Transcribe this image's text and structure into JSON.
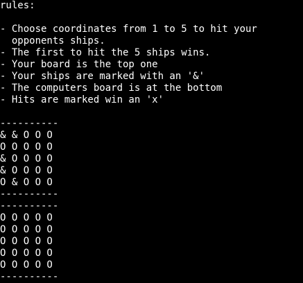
{
  "terminal": {
    "header": "rules:",
    "rules": [
      "- Choose coordinates from 1 to 5 to hit your",
      "  opponents ships.",
      "- The first to hit the 5 ships wins.",
      "- Your board is the top one",
      "- Your ships are marked with an '&'",
      "- The computers board is at the bottom",
      "- Hits are marked win an 'x'"
    ],
    "player_board": {
      "border_top": "----------",
      "rows": [
        "& & O O O",
        "O O O O O",
        "& O O O O",
        "& O O O O",
        "O & O O O"
      ],
      "border_bottom": "----------"
    },
    "computer_board": {
      "border_top": "----------",
      "rows": [
        "O O O O O",
        "O O O O O",
        "O O O O O",
        "O O O O O",
        "O O O O O"
      ],
      "border_bottom": "----------"
    }
  },
  "colors": {
    "background": "#000000",
    "text": "#ffffff"
  }
}
